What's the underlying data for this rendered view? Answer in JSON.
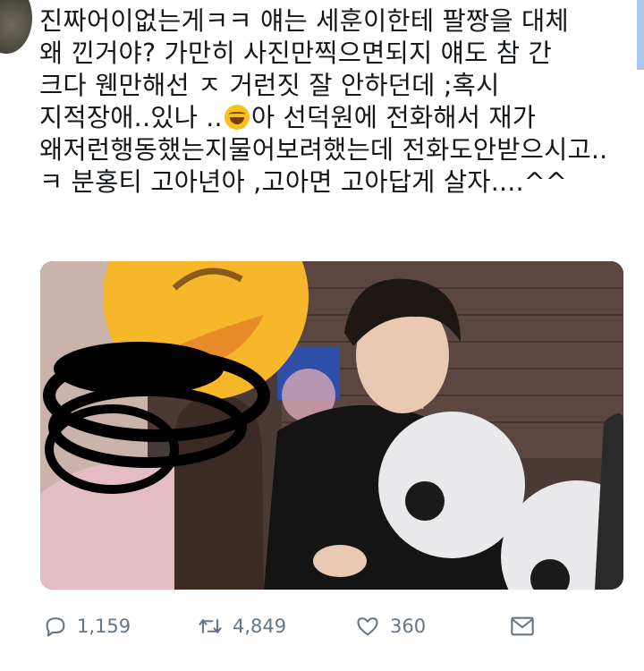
{
  "tweet": {
    "lines": [
      "진짜어이없는게ㅋㅋ 얘는 세훈이한테 팔짱을 대체",
      "왜 낀거야? 가만히 사진만찍으면되지 얘도 참 간",
      "크다 웬만해선 ㅈ 거런짓 잘 안하던데 ;혹시",
      "지적장애..있나 ..",
      "아 선덕원에 전화해서 재가",
      "왜저런행동했는지물어보려했는데 전화도안받으시고..",
      "ㅋ 분홍티 고아년아 ,고아면 고아답게 살자....^^"
    ],
    "emoji": "tears-of-joy-emoji"
  },
  "actions": {
    "reply_count": "1,159",
    "retweet_count": "4,849",
    "like_count": "360"
  },
  "icons": {
    "reply": "reply-icon",
    "retweet": "retweet-icon",
    "like": "heart-icon",
    "share": "dm-envelope-icon"
  },
  "colors": {
    "text": "#14171a",
    "muted": "#657786"
  }
}
